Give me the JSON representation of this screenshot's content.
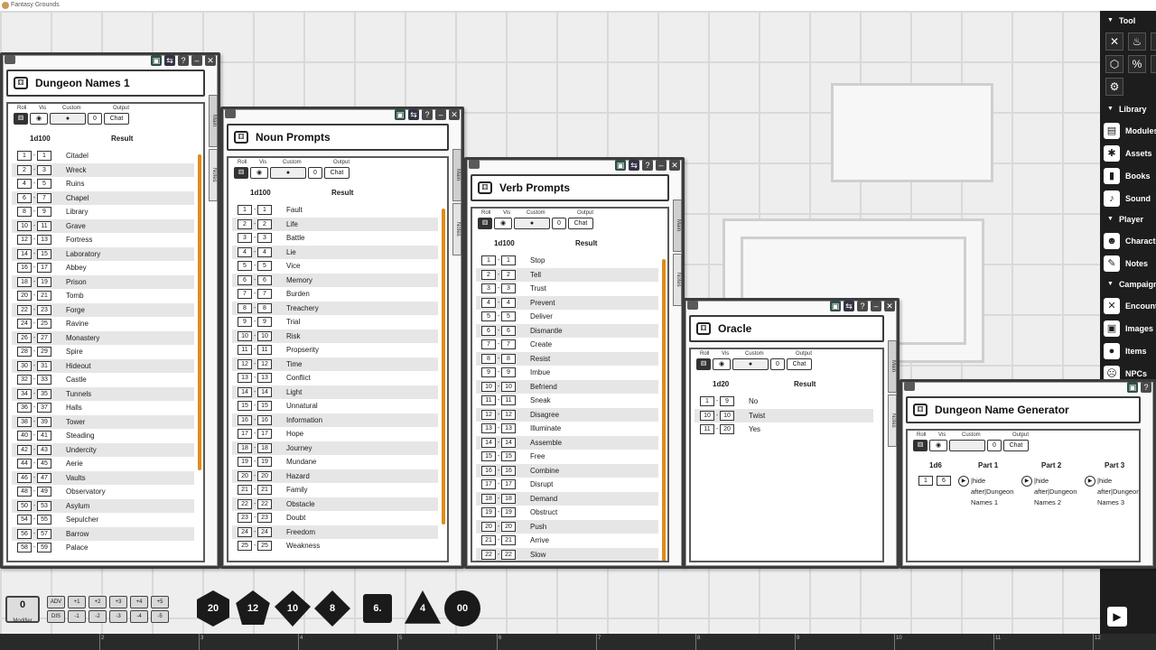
{
  "app": {
    "title": "Fantasy Grounds"
  },
  "sidebar": {
    "tool_header": "Tool",
    "tools": [
      {
        "icon": "crossed-swords-icon",
        "glyph": "✕"
      },
      {
        "icon": "potion-icon",
        "glyph": "♨"
      },
      {
        "icon": "pointer-icon",
        "glyph": "➚"
      },
      {
        "icon": "d20-icon",
        "glyph": "⬡"
      },
      {
        "icon": "percent-icon",
        "glyph": "%"
      },
      {
        "icon": "tool-icon",
        "glyph": "✎"
      },
      {
        "icon": "settings-icon",
        "glyph": "⚙"
      }
    ],
    "library_header": "Library",
    "library": [
      {
        "label": "Modules",
        "icon": "modules-icon",
        "glyph": "▤"
      },
      {
        "label": "Assets",
        "icon": "assets-icon",
        "glyph": "✱"
      },
      {
        "label": "Books",
        "icon": "books-icon",
        "glyph": "▮"
      },
      {
        "label": "Sound",
        "icon": "sound-icon",
        "glyph": "♪"
      }
    ],
    "player_header": "Player",
    "player": [
      {
        "label": "Characters",
        "icon": "characters-icon",
        "glyph": "☻"
      },
      {
        "label": "Notes",
        "icon": "notes-icon",
        "glyph": "✎"
      }
    ],
    "campaign_header": "Campaign",
    "campaign": [
      {
        "label": "Encounters",
        "icon": "encounters-icon",
        "glyph": "✕"
      },
      {
        "label": "Images",
        "icon": "images-icon",
        "glyph": "▣"
      },
      {
        "label": "Items",
        "icon": "items-icon",
        "glyph": "●"
      },
      {
        "label": "NPCs",
        "icon": "npcs-icon",
        "glyph": "☹"
      }
    ]
  },
  "controls": {
    "roll": "Roll",
    "vis": "Vis",
    "custom": "Custom",
    "output": "Output",
    "chat": "Chat",
    "mod": "0"
  },
  "side_tabs": {
    "main": "Main",
    "notes": "Notes"
  },
  "windows": {
    "dungeon_names": {
      "title": "Dungeon Names 1",
      "dice": "1d100",
      "result_header": "Result",
      "rows": [
        [
          "1",
          "1",
          "Citadel"
        ],
        [
          "2",
          "3",
          "Wreck"
        ],
        [
          "4",
          "5",
          "Ruins"
        ],
        [
          "6",
          "7",
          "Chapel"
        ],
        [
          "8",
          "9",
          "Library"
        ],
        [
          "10",
          "11",
          "Grave"
        ],
        [
          "12",
          "13",
          "Fortress"
        ],
        [
          "14",
          "15",
          "Laboratory"
        ],
        [
          "16",
          "17",
          "Abbey"
        ],
        [
          "18",
          "19",
          "Prison"
        ],
        [
          "20",
          "21",
          "Tomb"
        ],
        [
          "22",
          "23",
          "Forge"
        ],
        [
          "24",
          "25",
          "Ravine"
        ],
        [
          "26",
          "27",
          "Monastery"
        ],
        [
          "28",
          "29",
          "Spire"
        ],
        [
          "30",
          "31",
          "Hideout"
        ],
        [
          "32",
          "33",
          "Castle"
        ],
        [
          "34",
          "35",
          "Tunnels"
        ],
        [
          "36",
          "37",
          "Halls"
        ],
        [
          "38",
          "39",
          "Tower"
        ],
        [
          "40",
          "41",
          "Steading"
        ],
        [
          "42",
          "43",
          "Undercity"
        ],
        [
          "44",
          "45",
          "Aerie"
        ],
        [
          "46",
          "47",
          "Vaults"
        ],
        [
          "48",
          "49",
          "Observatory"
        ],
        [
          "50",
          "53",
          "Asylum"
        ],
        [
          "54",
          "55",
          "Sepulcher"
        ],
        [
          "56",
          "57",
          "Barrow"
        ],
        [
          "58",
          "59",
          "Palace"
        ]
      ]
    },
    "noun_prompts": {
      "title": "Noun Prompts",
      "dice": "1d100",
      "result_header": "Result",
      "rows": [
        [
          "1",
          "1",
          "Fault"
        ],
        [
          "2",
          "2",
          "Life"
        ],
        [
          "3",
          "3",
          "Battle"
        ],
        [
          "4",
          "4",
          "Lie"
        ],
        [
          "5",
          "5",
          "Vice"
        ],
        [
          "6",
          "6",
          "Memory"
        ],
        [
          "7",
          "7",
          "Burden"
        ],
        [
          "8",
          "8",
          "Treachery"
        ],
        [
          "9",
          "9",
          "Trial"
        ],
        [
          "10",
          "10",
          "Risk"
        ],
        [
          "11",
          "11",
          "Propserity"
        ],
        [
          "12",
          "12",
          "Time"
        ],
        [
          "13",
          "13",
          "Conflict"
        ],
        [
          "14",
          "14",
          "Light"
        ],
        [
          "15",
          "15",
          "Unnatural"
        ],
        [
          "16",
          "16",
          "Information"
        ],
        [
          "17",
          "17",
          "Hope"
        ],
        [
          "18",
          "18",
          "Journey"
        ],
        [
          "19",
          "19",
          "Mundane"
        ],
        [
          "20",
          "20",
          "Hazard"
        ],
        [
          "21",
          "21",
          "Family"
        ],
        [
          "22",
          "22",
          "Obstacle"
        ],
        [
          "23",
          "23",
          "Doubt"
        ],
        [
          "24",
          "24",
          "Freedom"
        ],
        [
          "25",
          "25",
          "Weakness"
        ]
      ]
    },
    "verb_prompts": {
      "title": "Verb Prompts",
      "dice": "1d100",
      "result_header": "Result",
      "rows": [
        [
          "1",
          "1",
          "Stop"
        ],
        [
          "2",
          "2",
          "Tell"
        ],
        [
          "3",
          "3",
          "Trust"
        ],
        [
          "4",
          "4",
          "Prevent"
        ],
        [
          "5",
          "5",
          "Deliver"
        ],
        [
          "6",
          "6",
          "Dismantle"
        ],
        [
          "7",
          "7",
          "Create"
        ],
        [
          "8",
          "8",
          "Resist"
        ],
        [
          "9",
          "9",
          "Imbue"
        ],
        [
          "10",
          "10",
          "Befriend"
        ],
        [
          "11",
          "11",
          "Sneak"
        ],
        [
          "12",
          "12",
          "Disagree"
        ],
        [
          "13",
          "13",
          "Illuminate"
        ],
        [
          "14",
          "14",
          "Assemble"
        ],
        [
          "15",
          "15",
          "Free"
        ],
        [
          "16",
          "16",
          "Combine"
        ],
        [
          "17",
          "17",
          "Disrupt"
        ],
        [
          "18",
          "18",
          "Demand"
        ],
        [
          "19",
          "19",
          "Obstruct"
        ],
        [
          "20",
          "20",
          "Push"
        ],
        [
          "21",
          "21",
          "Arrive"
        ],
        [
          "22",
          "22",
          "Slow"
        ]
      ]
    },
    "oracle": {
      "title": "Oracle",
      "dice": "1d20",
      "result_header": "Result",
      "rows": [
        [
          "1",
          "9",
          "No"
        ],
        [
          "10",
          "10",
          "Twist"
        ],
        [
          "11",
          "20",
          "Yes"
        ]
      ]
    },
    "generator": {
      "title": "Dungeon Name Generator",
      "dice": "1d6",
      "range": [
        "1",
        "6"
      ],
      "parts": [
        {
          "header": "Part 1",
          "text": "|hide after|Dungeon Names 1"
        },
        {
          "header": "Part 2",
          "text": "|hide after|Dungeon Names 2"
        },
        {
          "header": "Part 3",
          "text": "|hide after|Dungeon Names 3"
        }
      ]
    }
  },
  "modifier": {
    "value": "0",
    "label": "Modifier",
    "buttons": [
      "ADV",
      "+1",
      "+2",
      "+3",
      "+4",
      "+5",
      "DIS",
      "-1",
      "-2",
      "-3",
      "-4",
      "-5"
    ]
  },
  "dice": [
    {
      "name": "d20-die",
      "label": "20",
      "shape": "d20"
    },
    {
      "name": "d12-die",
      "label": "12",
      "shape": "d12"
    },
    {
      "name": "d10-die",
      "label": "10",
      "shape": "d10"
    },
    {
      "name": "d8-die",
      "label": "8",
      "shape": "d8"
    },
    {
      "name": "d6-die",
      "label": "6.",
      "shape": "d6"
    },
    {
      "name": "d4-die",
      "label": "4",
      "shape": "d4"
    },
    {
      "name": "d100-die",
      "label": "00",
      "shape": "d00"
    }
  ],
  "ruler": [
    "2",
    "3",
    "4",
    "5",
    "6",
    "7",
    "8",
    "9",
    "10",
    "11",
    "12"
  ]
}
